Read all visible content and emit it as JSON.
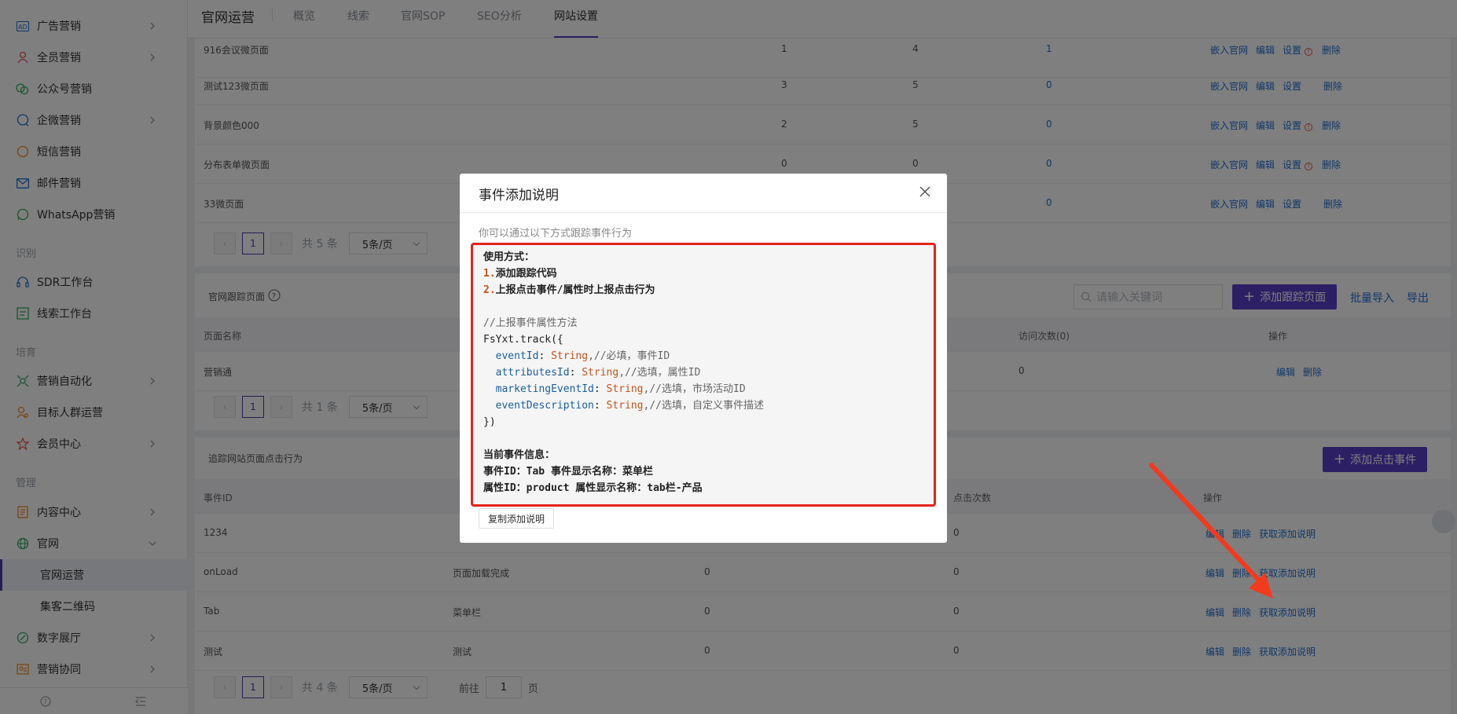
{
  "sidebar": {
    "items": [
      {
        "label": "广告营销",
        "icon": "ad-icon",
        "chevron": true
      },
      {
        "label": "全员营销",
        "icon": "people-icon",
        "chevron": true
      },
      {
        "label": "公众号营销",
        "icon": "wechat-icon",
        "chevron": false
      },
      {
        "label": "企微营销",
        "icon": "chat-icon",
        "chevron": true
      },
      {
        "label": "短信营销",
        "icon": "sms-icon",
        "chevron": false
      },
      {
        "label": "邮件营销",
        "icon": "mail-icon",
        "chevron": false
      },
      {
        "label": "WhatsApp营销",
        "icon": "whatsapp-icon",
        "chevron": false
      }
    ],
    "group_identify": "识别",
    "identify_items": [
      {
        "label": "SDR工作台",
        "icon": "headset-icon"
      },
      {
        "label": "线索工作台",
        "icon": "board-icon"
      }
    ],
    "group_nurture": "培育",
    "nurture_items": [
      {
        "label": "营销自动化",
        "icon": "automation-icon",
        "chevron": true
      },
      {
        "label": "目标人群运营",
        "icon": "target-icon",
        "chevron": false
      },
      {
        "label": "会员中心",
        "icon": "member-icon",
        "chevron": true
      }
    ],
    "group_manage": "管理",
    "manage_items": [
      {
        "label": "内容中心",
        "icon": "content-icon",
        "chevron": true
      },
      {
        "label": "官网",
        "icon": "globe-icon",
        "chevron": "down"
      }
    ],
    "sub_items": [
      {
        "label": "官网运营",
        "active": true
      },
      {
        "label": "集客二维码",
        "active": false
      }
    ],
    "bottom_items": [
      {
        "label": "数字展厅",
        "icon": "exhibit-icon",
        "chevron": true
      },
      {
        "label": "营销协同",
        "icon": "collab-icon",
        "chevron": true
      }
    ]
  },
  "topbar": {
    "title": "官网运营",
    "tabs": [
      "概览",
      "线索",
      "官网SOP",
      "SEO分析",
      "网站设置"
    ],
    "active_tab": "网站设置"
  },
  "micro_pages": {
    "rows": [
      {
        "name": "916会议微页面",
        "c1": "1",
        "c2": "4",
        "c3": "1",
        "warn": true
      },
      {
        "name": "测试123微页面",
        "c1": "3",
        "c2": "5",
        "c3": "0",
        "warn": false
      },
      {
        "name": "背景颜色000",
        "c1": "2",
        "c2": "5",
        "c3": "0",
        "warn": true
      },
      {
        "name": "分布表单微页面",
        "c1": "0",
        "c2": "0",
        "c3": "0",
        "warn": true
      },
      {
        "name": "33微页面",
        "c1": "",
        "c2": "",
        "c3": "0",
        "warn": false
      }
    ],
    "actions": [
      "嵌入官网",
      "编辑",
      "设置",
      "删除"
    ],
    "pager": {
      "page": "1",
      "total": "共 5 条",
      "size": "5条/页"
    }
  },
  "tracking_pages": {
    "title": "官网跟踪页面",
    "search_placeholder": "请输入关键词",
    "add_button": "添加跟踪页面",
    "import_link": "批量导入",
    "export_link": "导出",
    "headers": [
      "页面名称",
      "访问次数(0)",
      "操作"
    ],
    "rows": [
      {
        "name": "营销通",
        "visits": "0"
      }
    ],
    "actions": [
      "编辑",
      "删除"
    ],
    "pager": {
      "page": "1",
      "total": "共 1 条",
      "size": "5条/页"
    }
  },
  "click_events": {
    "title": "追踪网站页面点击行为",
    "add_button": "添加点击事件",
    "headers": [
      "事件ID",
      "点击次数",
      "操作"
    ],
    "rows": [
      {
        "id": "1234",
        "name": "",
        "c1": "",
        "clicks": "0"
      },
      {
        "id": "onLoad",
        "name": "页面加载完成",
        "c1": "0",
        "clicks": "0"
      },
      {
        "id": "Tab",
        "name": "菜单栏",
        "c1": "0",
        "clicks": "0"
      },
      {
        "id": "测试",
        "name": "测试",
        "c1": "0",
        "clicks": "0"
      }
    ],
    "actions": [
      "编辑",
      "删除",
      "获取添加说明"
    ],
    "pager": {
      "page": "1",
      "total": "共 4 条",
      "size": "5条/页",
      "goto_label": "前往",
      "goto_value": "1",
      "goto_unit": "页"
    }
  },
  "modal": {
    "title": "事件添加说明",
    "description": "你可以通过以下方式跟踪事件行为",
    "usage_title": "使用方式：",
    "step1_num": "1.",
    "step1": "添加跟踪代码",
    "step2_num": "2.",
    "step2": "上报点击事件/属性时上报点击行为",
    "comment": "//上报事件属性方法",
    "call_open": "FsYxt.track({",
    "params": [
      {
        "key": "eventId",
        "type": "String",
        "comment": ",//必填，事件ID"
      },
      {
        "key": "attributesId",
        "type": "String",
        "comment": ",//选填，属性ID"
      },
      {
        "key": "marketingEventId",
        "type": "String",
        "comment": ",//选填，市场活动ID"
      },
      {
        "key": "eventDescription",
        "type": "String",
        "comment": ",//选填，自定义事件描述"
      }
    ],
    "call_close": "})",
    "current_title": "当前事件信息：",
    "current_event": "事件ID：Tab 事件显示名称：菜单栏",
    "current_attr": "属性ID：product 属性显示名称：tab栏-产品",
    "copy_button": "复制添加说明"
  },
  "colors": {
    "accent": "#5b3fc9",
    "link": "#1f6fd4",
    "highlight": "#e3231c",
    "arrow": "#f23a1f"
  }
}
